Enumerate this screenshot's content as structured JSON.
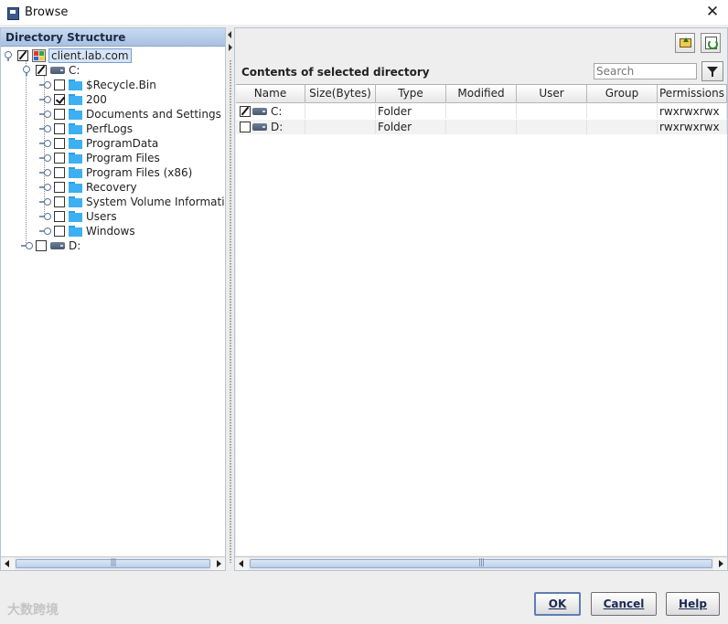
{
  "window": {
    "title": "Browse",
    "close_glyph": "✕"
  },
  "left_panel": {
    "header": "Directory Structure",
    "tree": [
      {
        "level": 0,
        "label": "client.lab.com",
        "icon": "host",
        "check": "partial",
        "expanded": true,
        "selected": true
      },
      {
        "level": 1,
        "label": "C:",
        "icon": "drive",
        "check": "partial",
        "expanded": true
      },
      {
        "level": 2,
        "label": "$Recycle.Bin",
        "icon": "folder",
        "check": "none"
      },
      {
        "level": 2,
        "label": "200",
        "icon": "folder",
        "check": "checked"
      },
      {
        "level": 2,
        "label": "Documents and Settings",
        "icon": "folder",
        "check": "none"
      },
      {
        "level": 2,
        "label": "PerfLogs",
        "icon": "folder",
        "check": "none"
      },
      {
        "level": 2,
        "label": "ProgramData",
        "icon": "folder",
        "check": "none"
      },
      {
        "level": 2,
        "label": "Program Files",
        "icon": "folder",
        "check": "none"
      },
      {
        "level": 2,
        "label": "Program Files (x86)",
        "icon": "folder",
        "check": "none"
      },
      {
        "level": 2,
        "label": "Recovery",
        "icon": "folder",
        "check": "none"
      },
      {
        "level": 2,
        "label": "System Volume Information",
        "icon": "folder",
        "check": "none"
      },
      {
        "level": 2,
        "label": "Users",
        "icon": "folder",
        "check": "none"
      },
      {
        "level": 2,
        "label": "Windows",
        "icon": "folder",
        "check": "none"
      },
      {
        "level": 1,
        "label": "D:",
        "icon": "drive",
        "check": "none"
      }
    ]
  },
  "right_panel": {
    "title": "Contents of selected directory",
    "search": {
      "placeholder": "Search",
      "value": ""
    },
    "toolbar_icons": [
      "up-folder-icon",
      "refresh-icon"
    ],
    "columns": [
      "Name",
      "Size(Bytes)",
      "Type",
      "Modified",
      "User",
      "Group",
      "Permissions"
    ],
    "rows": [
      {
        "check": "partial",
        "name": "C:",
        "size": "",
        "type": "Folder",
        "modified": "",
        "user": "",
        "group": "",
        "permissions": "rwxrwxrwx"
      },
      {
        "check": "none",
        "name": "D:",
        "size": "",
        "type": "Folder",
        "modified": "",
        "user": "",
        "group": "",
        "permissions": "rwxrwxrwx"
      }
    ]
  },
  "buttons": {
    "ok": "OK",
    "cancel": "Cancel",
    "help": "Help"
  },
  "watermark": "大数跨境",
  "colors": {
    "header_blue": "#a7c1e2",
    "folder_blue": "#3cb0f2",
    "button_text": "#1a2a55"
  }
}
